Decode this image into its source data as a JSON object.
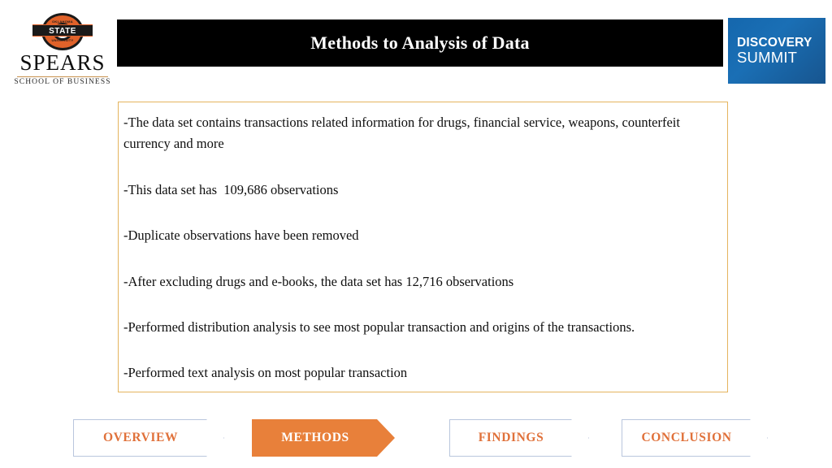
{
  "slide": {
    "title": "Methods to Analysis of Data"
  },
  "logo": {
    "mark_top_text": "OKLAHOMA",
    "mark_banner_text": "STATE",
    "mark_bottom_text": "UNIVERSITY",
    "wordmark": "SPEARS",
    "subtitle": "SCHOOL OF BUSINESS"
  },
  "summit_logo": {
    "line1": "DISCOVERY",
    "line2": "SUMMIT",
    "background_color": "#1567ad"
  },
  "content": {
    "bullets": [
      "-The data set contains transactions related information for drugs, financial service, weapons, counterfeit currency and more",
      "-This data set has  109,686 observations",
      "-Duplicate observations have been removed",
      "-After excluding drugs and e-books, the data set has 12,716 observations",
      "-Performed distribution analysis to see most popular transaction and origins of the transactions.",
      "-Performed text analysis on most popular transaction"
    ],
    "border_color": "#e5b45e"
  },
  "nav": {
    "active_color": "#e8803a",
    "inactive_text_color": "#e0713a",
    "items": [
      {
        "label": "OVERVIEW",
        "active": false
      },
      {
        "label": "METHODS",
        "active": true
      },
      {
        "label": "FINDINGS",
        "active": false
      },
      {
        "label": "CONCLUSION",
        "active": false
      }
    ]
  }
}
